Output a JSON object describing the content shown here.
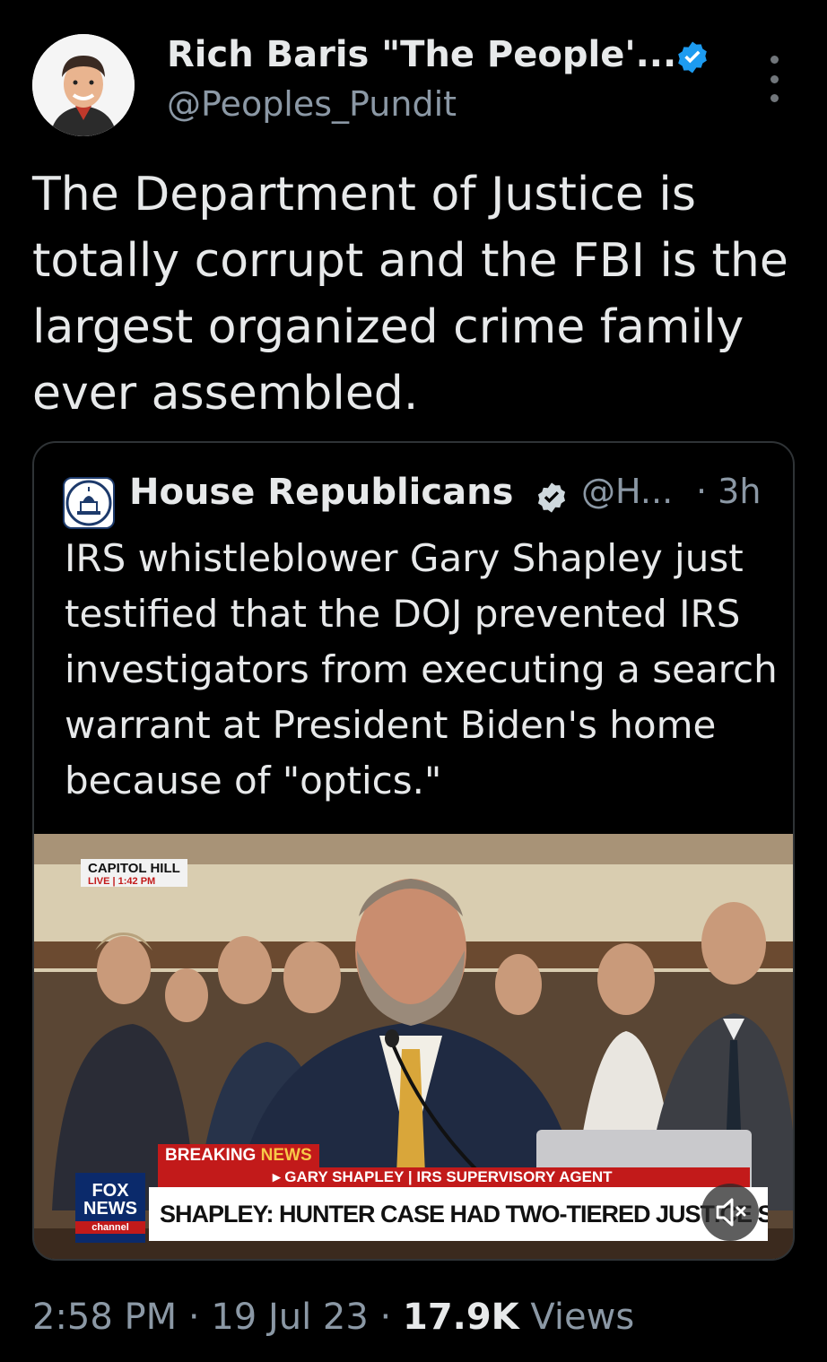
{
  "tweet": {
    "author_name": "Rich Baris \"The People'...",
    "author_handle": "@Peoples_Pundit",
    "text": "The Department of Justice is totally corrupt and the FBI is the largest organized crime family ever assembled.",
    "time": "2:58 PM",
    "date": "19 Jul 23",
    "separator": "·",
    "views_count": "17.9K",
    "views_label": "Views"
  },
  "quoted_tweet": {
    "author_name": "House Republicans",
    "author_handle": "@H...",
    "age": "· 3h",
    "text": "IRS whistleblower Gary Shapley just testified that the DOJ prevented IRS investigators from executing a search warrant at President Biden's home because of \"optics.\""
  },
  "video": {
    "tag_line1": "CAPITOL HILL",
    "tag_line2": "LIVE | 1:42 PM",
    "breaking_label": "BREAKING",
    "breaking_news": "NEWS",
    "subline": "▸ GARY SHAPLEY | IRS SUPERVISORY AGENT",
    "headline": "SHAPLEY: HUNTER CASE HAD TWO-TIERED JUSTICE SYSTEM",
    "logo_line1": "FOX",
    "logo_line2": "NEWS",
    "logo_line3": "channel"
  },
  "colors": {
    "background": "#000000",
    "text": "#e7e9ea",
    "muted": "#8b98a5",
    "verified": "#1d9bf0",
    "fox_red": "#c21a1a"
  },
  "icons": [
    "verified-icon",
    "more-icon",
    "speaker-muted-icon"
  ]
}
